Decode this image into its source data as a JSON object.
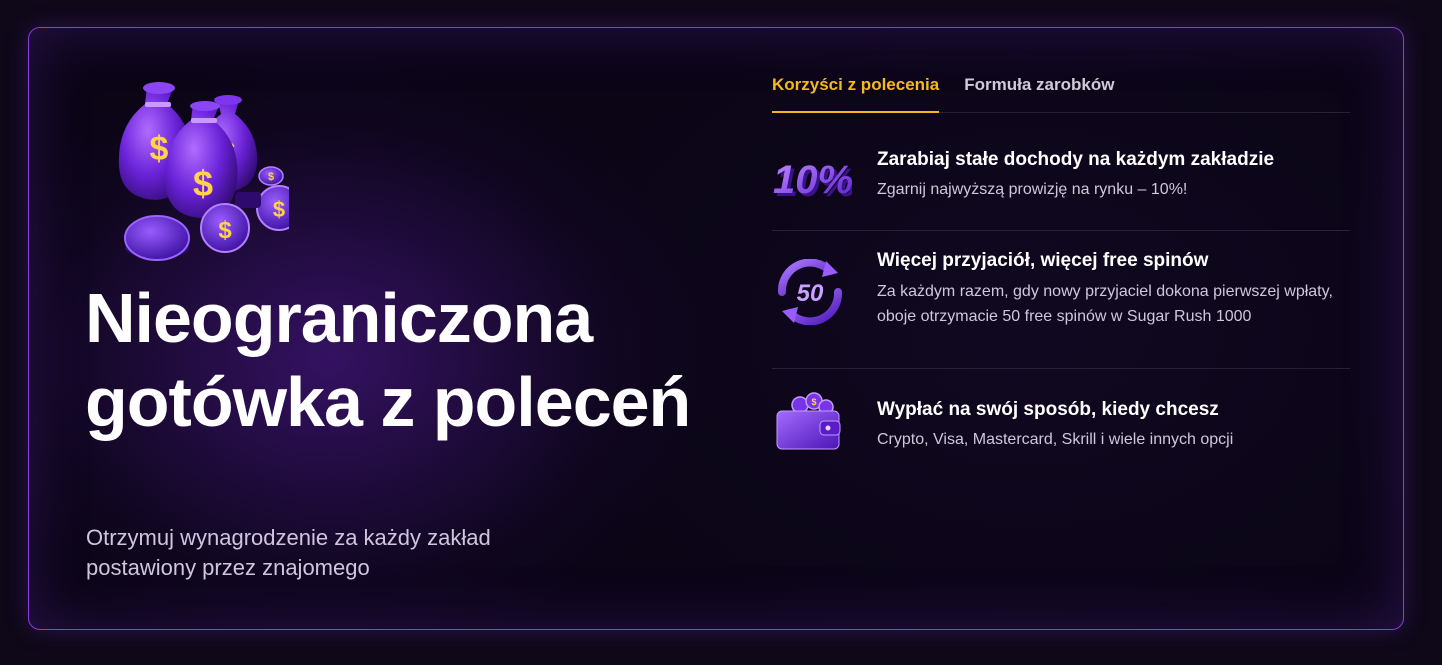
{
  "hero": {
    "image": "money-bags-coins-icon",
    "title": "Nieograniczona gotówka z poleceń",
    "subtitle": "Otrzymuj wynagrodzenie za każdy zakład postawiony przez znajomego"
  },
  "tabs": [
    {
      "label": "Korzyści z polecenia",
      "active": true
    },
    {
      "label": "Formuła zarobków",
      "active": false
    }
  ],
  "benefits": [
    {
      "icon": "ten-percent-icon",
      "title": "Zarabiaj stałe dochody na każdym zakładzie",
      "description": "Zgarnij najwyższą prowizję na rynku – 10%!",
      "badge": "10%"
    },
    {
      "icon": "fifty-spins-icon",
      "title": "Więcej przyjaciół, więcej free spinów",
      "description": "Za każdym razem, gdy nowy przyjaciel dokona pierwszej wpłaty, oboje otrzymacie 50 free spinów w Sugar Rush 1000",
      "badge": "50"
    },
    {
      "icon": "wallet-icon",
      "title": "Wypłać na swój sposób, kiedy chcesz",
      "description": "Crypto, Visa, Mastercard, Skrill i wiele innych opcji"
    }
  ],
  "colors": {
    "accent": "#f6b91b",
    "border": "#8a3fd6",
    "background": "#0b0516",
    "icon_purple": "#8b3cf0"
  }
}
